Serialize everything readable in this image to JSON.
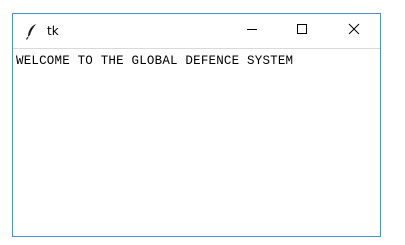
{
  "window": {
    "title": "tk",
    "icon": "tk-feather-icon",
    "controls": {
      "minimize": "minimize-icon",
      "maximize": "maximize-icon",
      "close": "close-icon"
    }
  },
  "content": {
    "label_text": "WELCOME TO THE GLOBAL DEFENCE SYSTEM"
  },
  "colors": {
    "window_border": "#4a8ed4",
    "background": "#ffffff",
    "text": "#000000"
  }
}
